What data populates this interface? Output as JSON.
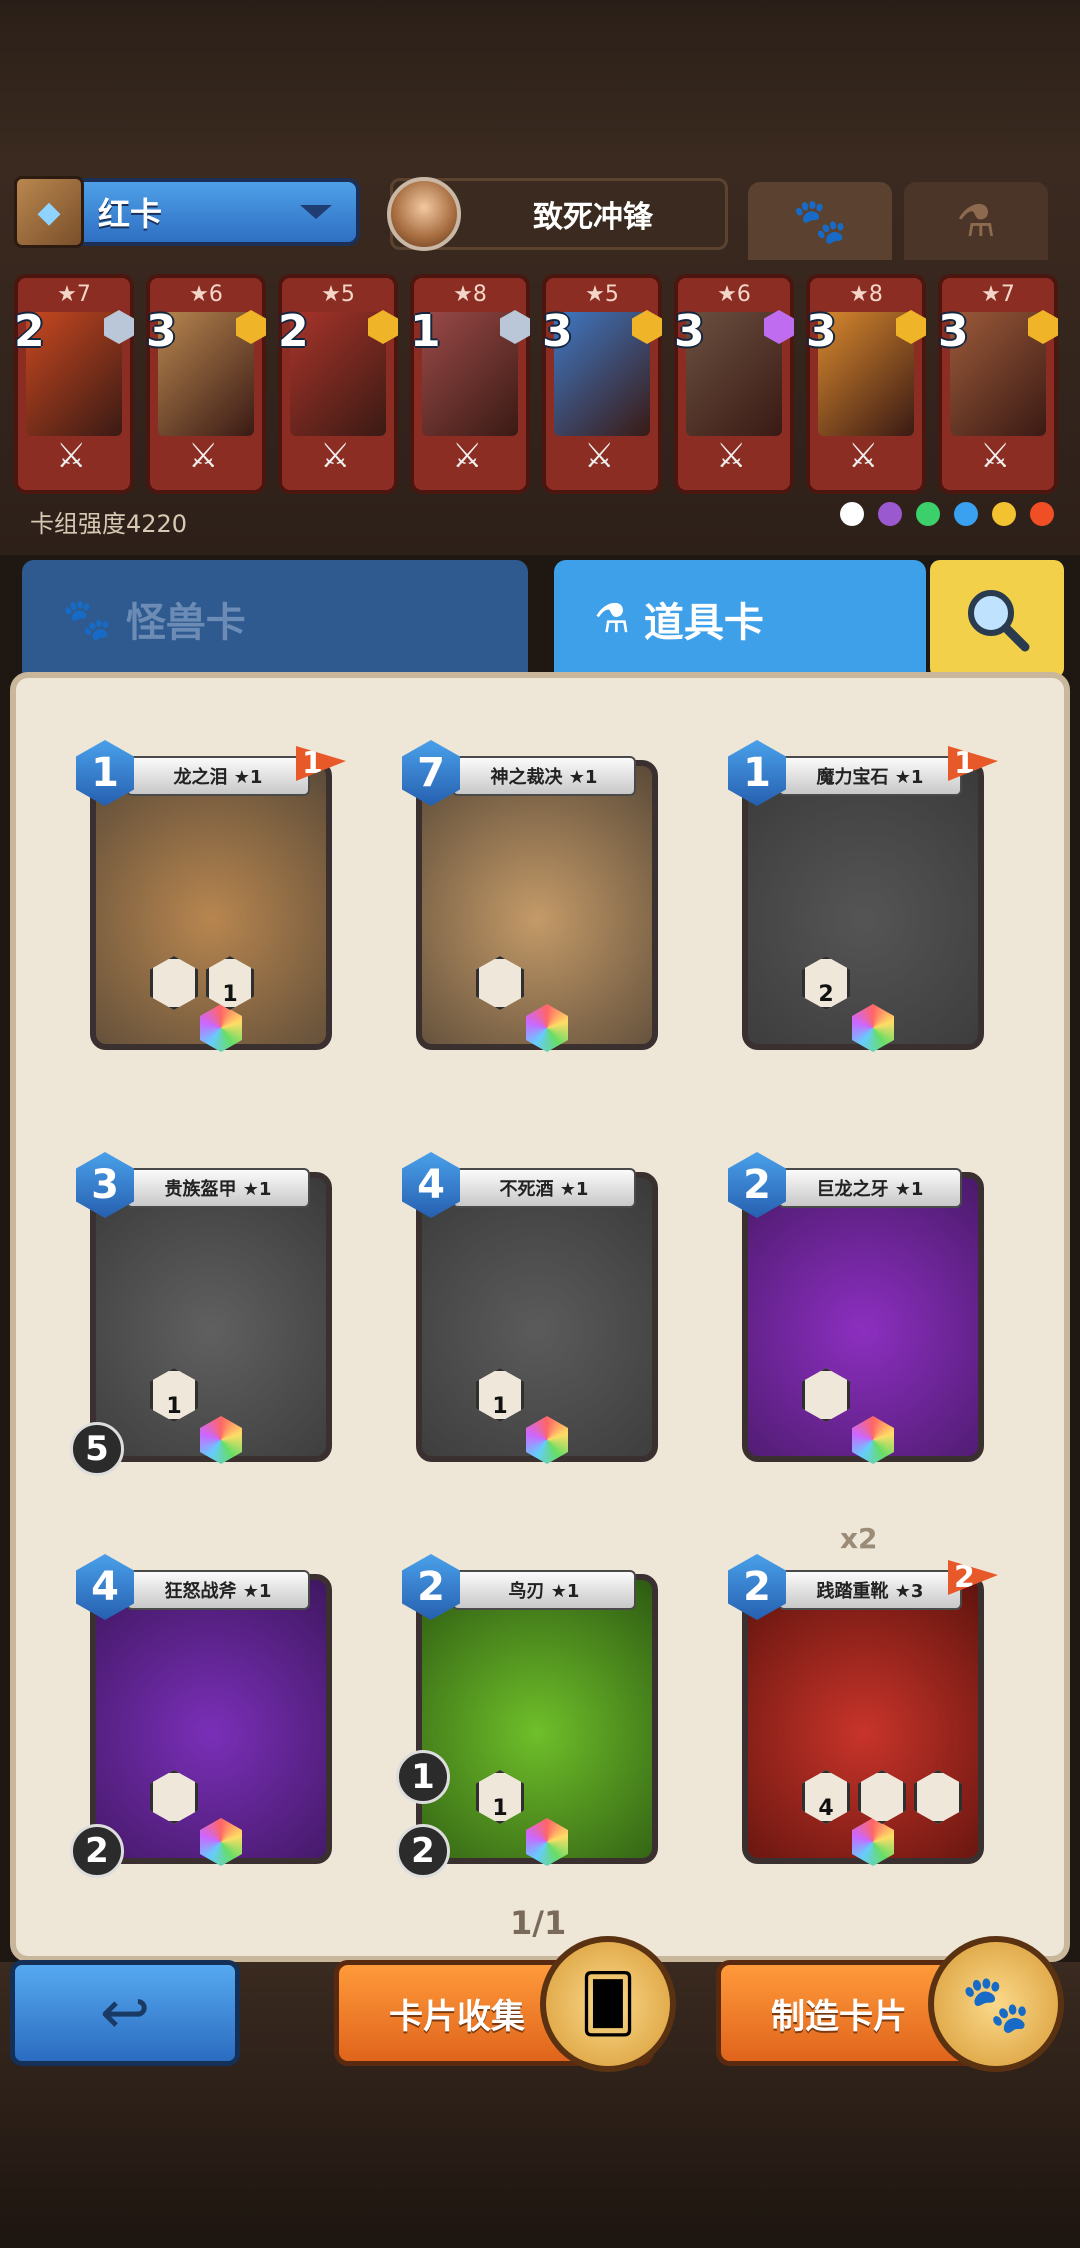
{
  "deck": {
    "name": "红卡",
    "hero_name": "致死冲锋",
    "power_label": "卡组强度4220",
    "tab_icons": [
      "paw-icon",
      "potion-icon"
    ]
  },
  "deck_cards": [
    {
      "stars": "★7",
      "cost": "2",
      "gem_color": "#b9c7d8",
      "art": "#c84820"
    },
    {
      "stars": "★6",
      "cost": "3",
      "gem_color": "#f0b429",
      "art": "#b7864f"
    },
    {
      "stars": "★5",
      "cost": "2",
      "gem_color": "#f0b429",
      "art": "#a8342a"
    },
    {
      "stars": "★8",
      "cost": "1",
      "gem_color": "#b9c7d8",
      "art": "#9a4a48"
    },
    {
      "stars": "★5",
      "cost": "3",
      "gem_color": "#f0b429",
      "art": "#3f78c5"
    },
    {
      "stars": "★6",
      "cost": "3",
      "gem_color": "#c06cf0",
      "art": "#6b5040"
    },
    {
      "stars": "★8",
      "cost": "3",
      "gem_color": "#f0b429",
      "art": "#d9892e"
    },
    {
      "stars": "★7",
      "cost": "3",
      "gem_color": "#f0b429",
      "art": "#9c5a3a"
    }
  ],
  "elements": [
    "#ffffff",
    "#9b59d0",
    "#3bd06a",
    "#3aa0f0",
    "#f3c231",
    "#f04e24"
  ],
  "tabs": {
    "monster": "怪兽卡",
    "item": "道具卡",
    "search_icon": "search-icon"
  },
  "item_cards": [
    {
      "name": "龙之泪 ★1",
      "cost": "1",
      "flag": "1",
      "theme": "#b8864f",
      "frame": "#5a4a38",
      "stats": [
        "",
        "1"
      ]
    },
    {
      "name": "神之裁决 ★1",
      "cost": "7",
      "flag": "",
      "theme": "#c49a68",
      "frame": "#5a4a38",
      "stats": [
        ""
      ]
    },
    {
      "name": "魔力宝石 ★1",
      "cost": "1",
      "flag": "1",
      "theme": "#555555",
      "frame": "#3a3a3a",
      "stats": [
        "2"
      ]
    },
    {
      "name": "贵族盔甲 ★1",
      "cost": "3",
      "flag": "",
      "theme": "#606060",
      "frame": "#3a3a3a",
      "stats": [
        "1"
      ],
      "side": "5"
    },
    {
      "name": "不死酒 ★1",
      "cost": "4",
      "flag": "",
      "theme": "#5b5b5b",
      "frame": "#3a3a3a",
      "stats": [
        "1"
      ]
    },
    {
      "name": "巨龙之牙 ★1",
      "cost": "2",
      "flag": "",
      "theme": "#8c2fc0",
      "frame": "#4a1a6a",
      "stats": [
        ""
      ]
    },
    {
      "name": "狂怒战斧 ★1",
      "cost": "4",
      "flag": "",
      "theme": "#7a2fb8",
      "frame": "#3f1760",
      "stats": [
        ""
      ],
      "side": "2"
    },
    {
      "name": "鸟刃 ★1",
      "cost": "2",
      "flag": "",
      "theme": "#6fbf2a",
      "frame": "#2d5a12",
      "stats": [
        "1"
      ],
      "side": "2",
      "side2": "1"
    },
    {
      "name": "践踏重靴 ★3",
      "cost": "2",
      "flag": "2",
      "theme": "#c8342a",
      "frame": "#5e130d",
      "stats": [
        "4",
        "",
        ""
      ],
      "multiplier": "x2"
    }
  ],
  "pagination": "1/1",
  "buttons": {
    "back_icon": "back-arrow-icon",
    "collect": "卡片收集",
    "craft": "制造卡片"
  }
}
